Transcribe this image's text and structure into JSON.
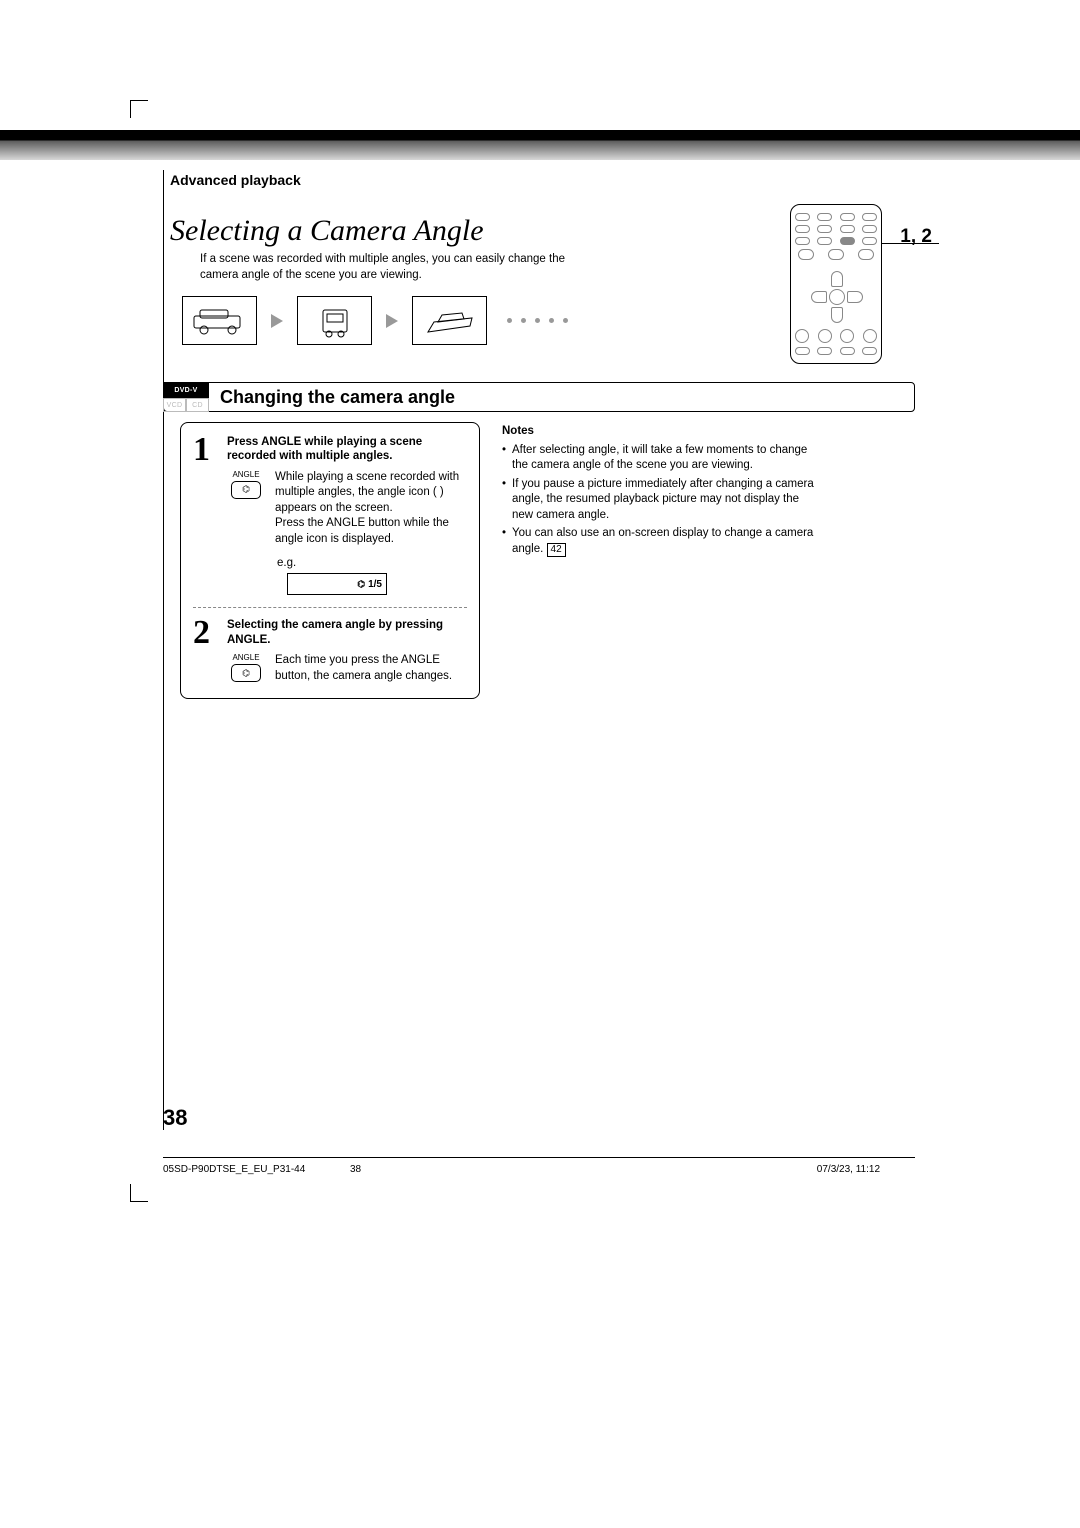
{
  "header": {
    "section": "Advanced playback"
  },
  "title": "Selecting a Camera Angle",
  "subtitle": "If a scene was recorded with multiple angles, you can easily change the camera angle of the scene you are viewing.",
  "remote_label": "1, 2",
  "disc_tags": {
    "dvd": "DVD-V",
    "vcd": "VCD",
    "cd": "CD"
  },
  "section_heading": "Changing the camera angle",
  "steps": [
    {
      "num": "1",
      "head": "Press ANGLE while playing a scene recorded with multiple angles.",
      "button_label": "ANGLE",
      "body1": "While playing a scene recorded with multiple angles, the angle icon (   ) appears on the screen.",
      "body2": "Press the ANGLE button while the angle icon is displayed.",
      "eg_label": "e.g.",
      "eg_value": "1/5"
    },
    {
      "num": "2",
      "head": "Selecting the camera angle by pressing ANGLE.",
      "button_label": "ANGLE",
      "body1": "Each time you press the ANGLE button, the camera angle changes."
    }
  ],
  "notes": {
    "heading": "Notes",
    "items": [
      "After selecting angle, it will take a few moments to change the camera angle of the scene you are viewing.",
      "If you pause a picture immediately after changing a camera angle, the resumed playback picture may not display the new camera angle.",
      "You can also use an on-screen display to change a camera angle."
    ],
    "ref": "42"
  },
  "page_number": "38",
  "footer": {
    "left": "05SD-P90DTSE_E_EU_P31-44",
    "center": "38",
    "right": "07/3/23, 11:12"
  }
}
